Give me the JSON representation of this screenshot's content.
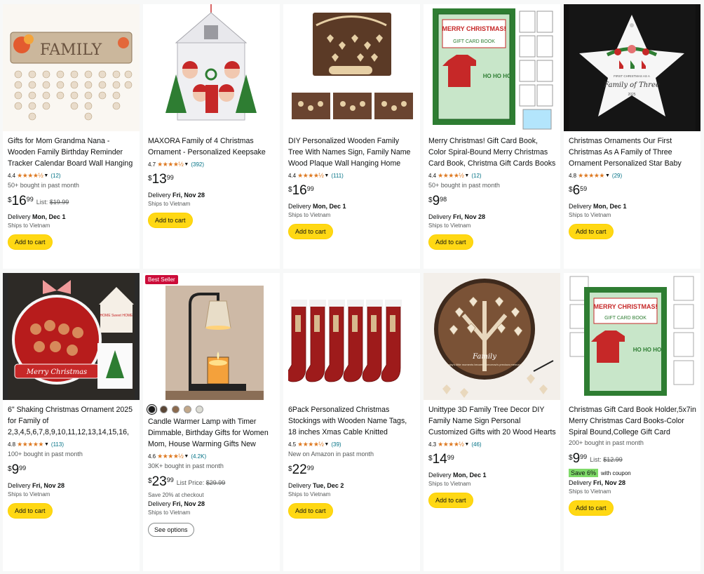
{
  "products": [
    {
      "title": "Gifts for Mom Grandma Nana - Wooden Family Birthday Reminder Tracker Calendar Board Wall Hanging - Family Birthday Plaque with Tags…",
      "rating": "4.4",
      "stars": "★★★★½",
      "reviews": "(12)",
      "bought": "50+ bought in past month",
      "price_whole": "16",
      "price_frac": "99",
      "list_label": "List:",
      "list_price": "$19.99",
      "delivery_label": "Delivery",
      "delivery_date": "Mon, Dec 1",
      "ships": "Ships to Vietnam",
      "cart": "Add to cart",
      "image_text": "FAMILY"
    },
    {
      "title": "MAXORA Family of 4 Christmas Ornament - Personalized Keepsake Gift for Family Tree Decorations",
      "rating": "4.7",
      "stars": "★★★★½",
      "reviews": "(392)",
      "price_whole": "13",
      "price_frac": "99",
      "delivery_label": "Delivery",
      "delivery_date": "Fri, Nov 28",
      "ships": "Ships to Vietnam",
      "cart": "Add to cart"
    },
    {
      "title": "DIY Personalized Wooden Family Tree With Names Sign, Family Name Wood Plaque Wall Hanging Home Decor, Family Tree Plaques With…",
      "rating": "4.4",
      "stars": "★★★★½",
      "reviews": "(111)",
      "price_whole": "16",
      "price_frac": "99",
      "delivery_label": "Delivery",
      "delivery_date": "Mon, Dec 1",
      "ships": "Ships to Vietnam",
      "cart": "Add to cart"
    },
    {
      "title": "Merry Christmas! Gift Card Book, Color Spiral-Bound Merry Christmas Card Book, Christma Gift Cards Books Holder, DIY Personalized Xmas Gift…",
      "rating": "4.4",
      "stars": "★★★★½",
      "reviews": "(12)",
      "bought": "50+ bought in past month",
      "price_whole": "9",
      "price_frac": "98",
      "delivery_label": "Delivery",
      "delivery_date": "Fri, Nov 28",
      "ships": "Ships to Vietnam",
      "cart": "Add to cart",
      "image_text": "MERRY CHRISTMAS!",
      "image_sub": "GIFT CARD BOOK",
      "image_hoho": "HO HO HO"
    },
    {
      "title": "Christmas Ornaments Our First Christmas As A Family of Three Ornament Personalized Star Baby First Xmas Ornaments 2025 Girls…",
      "rating": "4.8",
      "stars": "★★★★★",
      "reviews": "(29)",
      "price_whole": "6",
      "price_frac": "59",
      "delivery_label": "Delivery",
      "delivery_date": "Mon, Dec 1",
      "ships": "Ships to Vietnam",
      "cart": "Add to cart",
      "image_text": "FIRST CHRISTMAS AS A",
      "image_sub": "Family of Three",
      "image_year": "2025"
    },
    {
      "title": "6\" Shaking Christmas Ornament 2025 for Family of 2,3,4,5,6,7,8,9,10,11,12,13,14,15,16, DIY Gingerbread Keepsake with Do…",
      "rating": "4.8",
      "stars": "★★★★★",
      "reviews": "(113)",
      "bought": "100+ bought in past month",
      "price_whole": "9",
      "price_frac": "99",
      "delivery_label": "Delivery",
      "delivery_date": "Fri, Nov 28",
      "ships": "Ships to Vietnam",
      "cart": "Add to cart",
      "image_text": "Merry Christmas",
      "image_sub": "HOME Sweet HOME"
    },
    {
      "badge": "Best Seller",
      "title": "Candle Warmer Lamp with Timer Dimmable, Birthday Gifts for Women Mom, House Warming Gifts New Home Decor, Wax Melt Warmer for…",
      "rating": "4.6",
      "stars": "★★★★½",
      "reviews": "(4.2K)",
      "bought": "30K+ bought in past month",
      "price_whole": "23",
      "price_frac": "99",
      "list_label": "List Price:",
      "list_price": "$29.99",
      "note": "Save 20% at checkout",
      "delivery_label": "Delivery",
      "delivery_date": "Fri, Nov 28",
      "ships": "Ships to Vietnam",
      "options": "See options",
      "swatch_colors": [
        "#1a1a1a",
        "#5a4636",
        "#8b6a4e",
        "#c2a88a",
        "#dcdcd4"
      ]
    },
    {
      "title": "6Pack Personalized Christmas Stockings with Wooden Name Tags, 18 inches Xmas Cable Knitted Stocking for Holiday, Hanging…",
      "rating": "4.5",
      "stars": "★★★★½",
      "reviews": "(39)",
      "bought": "New on Amazon in past month",
      "price_whole": "22",
      "price_frac": "99",
      "delivery_label": "Delivery",
      "delivery_date": "Tue, Dec 2",
      "ships": "Ships to Vietnam",
      "cart": "Add to cart"
    },
    {
      "title": "Unittype 3D Family Tree Decor DIY Family Name Sign Personal Customized Gifts with 20 Wood Hearts 30 Hook Loops Stickers for…",
      "rating": "4.3",
      "stars": "★★★★½",
      "reviews": "(46)",
      "price_whole": "14",
      "price_frac": "99",
      "delivery_label": "Delivery",
      "delivery_date": "Mon, Dec 1",
      "ships": "Ships to Vietnam",
      "cart": "Add to cart",
      "image_text": "Family",
      "image_sub": "Today's little moments become tomorrow's precious memories"
    },
    {
      "title": "Christmas Gift Card Book Holder,5x7in Merry Christmas Card Books-Color Spiral Bound,College Gift Card Book,DIY Personalized…",
      "bought": "200+ bought in past month",
      "price_whole": "9",
      "price_frac": "99",
      "list_label": "List:",
      "list_price": "$12.99",
      "coupon_badge": "Save 6%",
      "coupon_text": "with coupon",
      "delivery_label": "Delivery",
      "delivery_date": "Fri, Nov 28",
      "ships": "Ships to Vietnam",
      "cart": "Add to cart",
      "image_text": "MERRY CHRISTMAS!",
      "image_sub": "GIFT CARD BOOK",
      "image_hoho": "HO HO HO"
    }
  ]
}
